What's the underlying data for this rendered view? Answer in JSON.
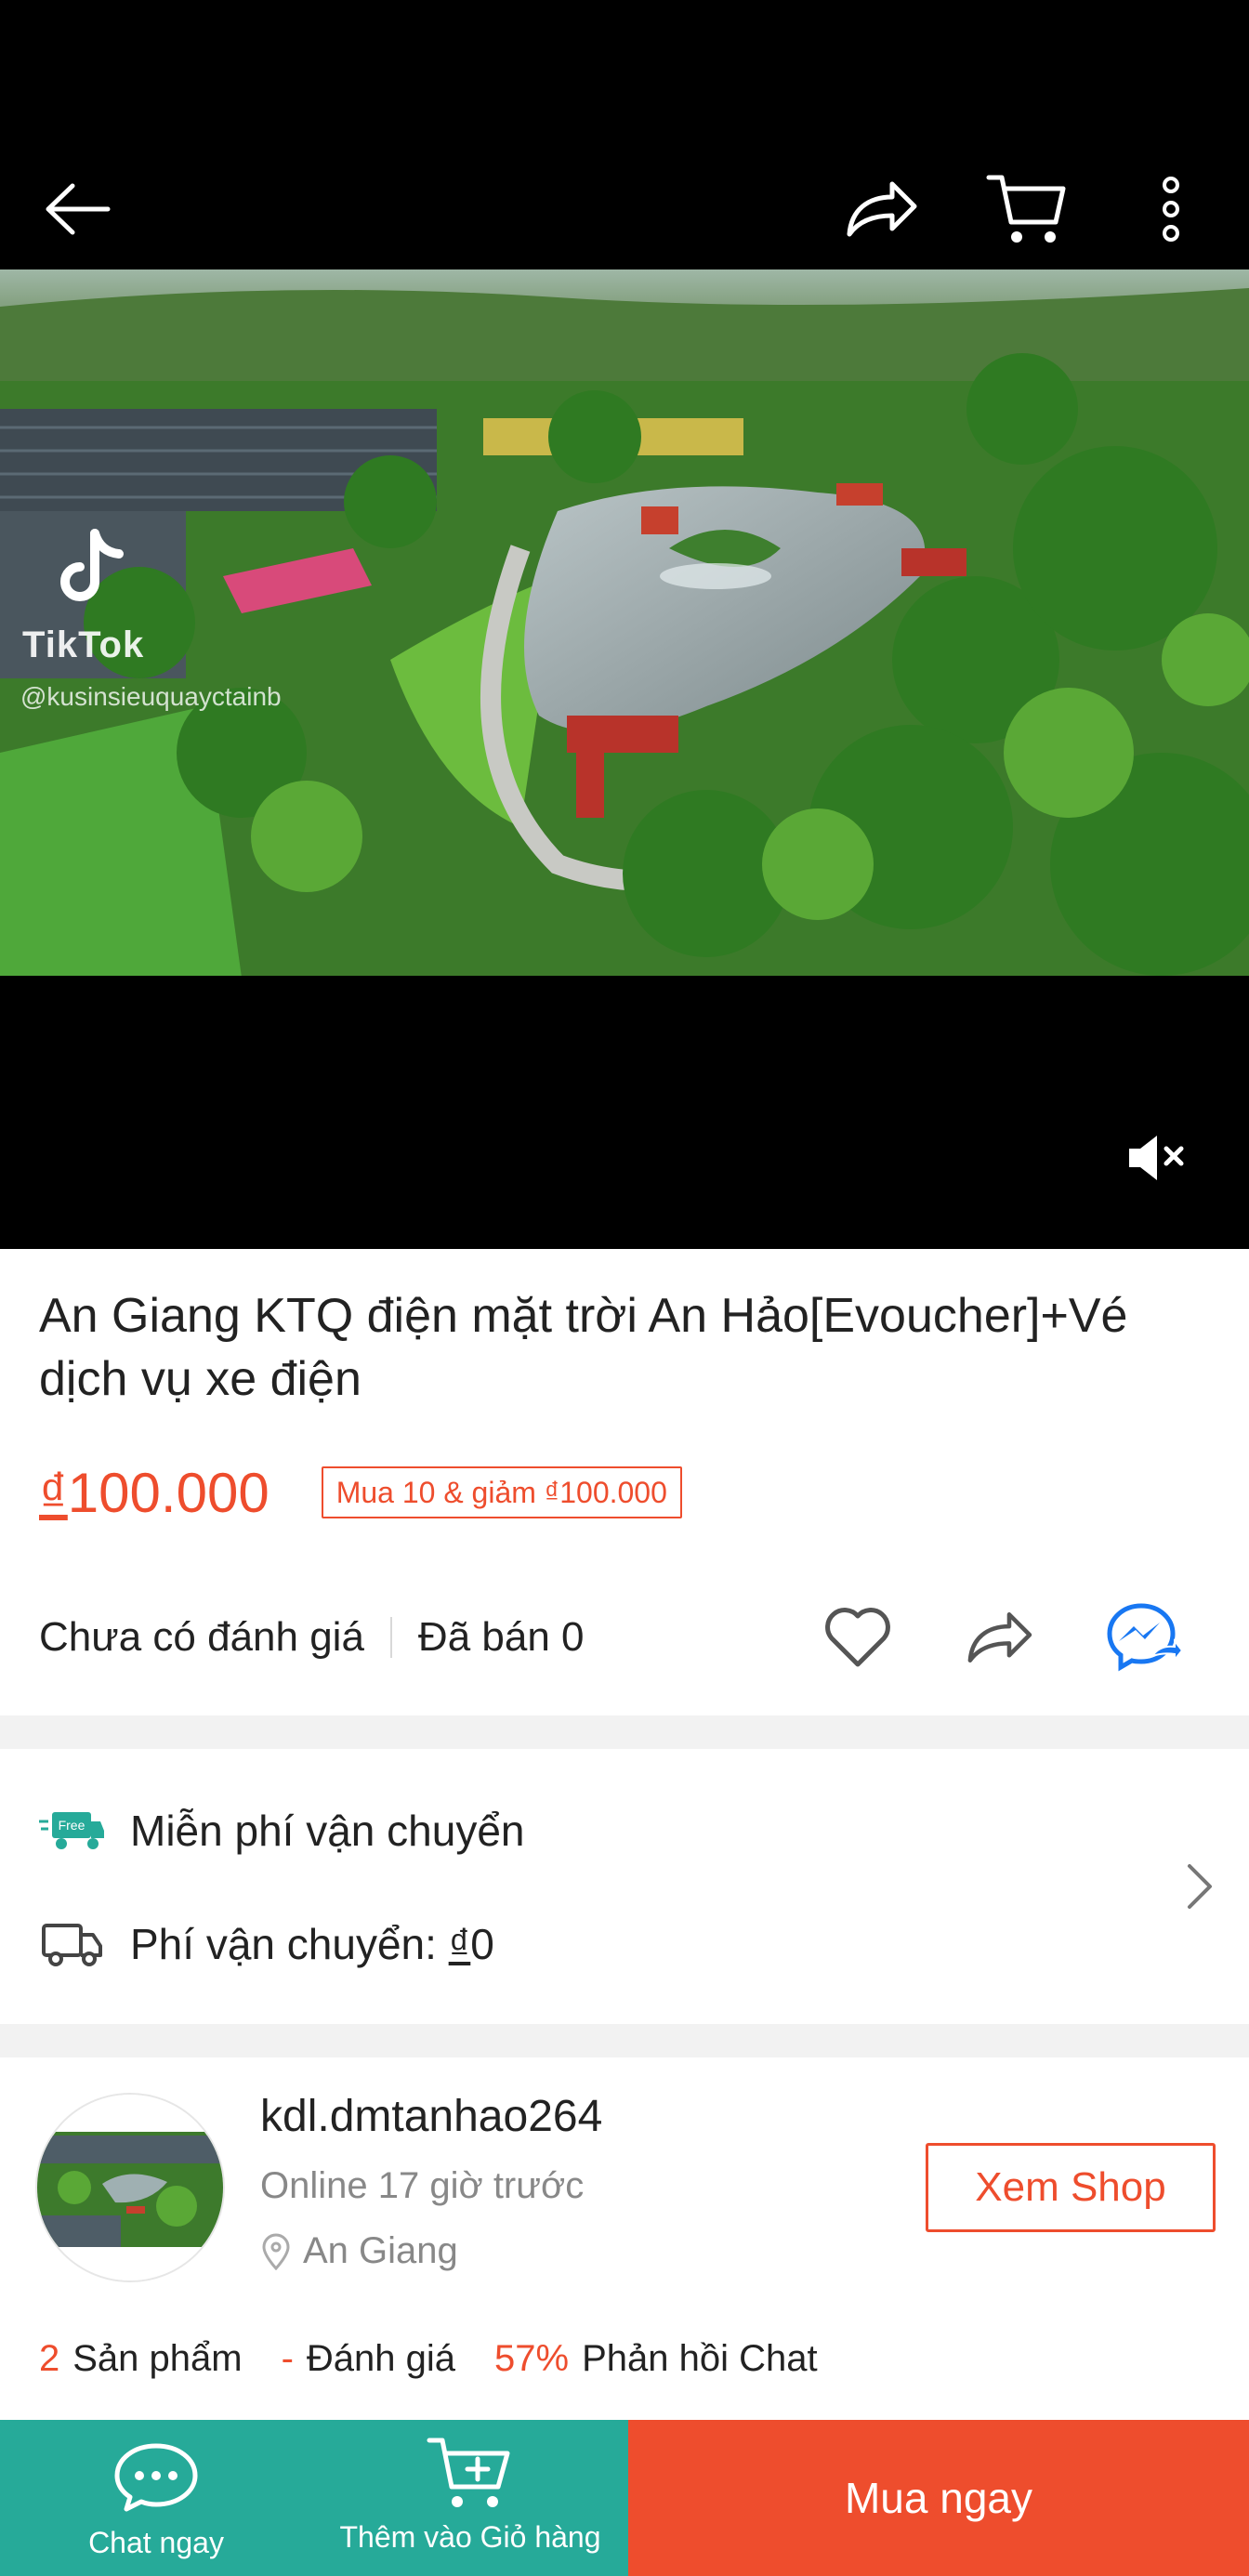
{
  "media": {
    "watermark_brand": "TikTok",
    "watermark_handle": "@kusinsieuquayctainb"
  },
  "product": {
    "title": "An Giang KTQ điện mặt trời An Hảo[Evoucher]+Vé dịch vụ xe điện",
    "price_currency": "₫",
    "price_value": "100.000",
    "promo_badge": "Mua 10 & giảm ₫100.000",
    "rating_text": "Chưa có đánh giá",
    "sold_text": "Đã bán 0"
  },
  "shipping": {
    "free_label": "Miễn phí vận chuyển",
    "fee_label": "Phí vận chuyển: ",
    "fee_currency": "₫",
    "fee_value": "0",
    "free_badge": "Free"
  },
  "shop": {
    "name": "kdl.dmtanhao264",
    "online": "Online 17 giờ trước",
    "location": "An Giang",
    "view_button": "Xem Shop",
    "products_count": "2",
    "products_label": "Sản phẩm",
    "ratings_count": "-",
    "ratings_label": "Đánh giá",
    "chat_response_rate": "57%",
    "chat_response_label": "Phản hồi Chat"
  },
  "bottom_bar": {
    "chat_label": "Chat ngay",
    "add_to_cart_label": "Thêm vào Giỏ hàng",
    "buy_now_label": "Mua ngay"
  },
  "colors": {
    "accent": "#ee4d2d",
    "teal": "#26aa99",
    "messenger_blue": "#1877f2"
  },
  "icons": [
    "back-arrow-icon",
    "share-icon",
    "cart-icon",
    "more-vertical-icon",
    "mute-icon",
    "heart-icon",
    "messenger-icon",
    "free-shipping-truck-icon",
    "truck-icon",
    "chevron-right-icon",
    "location-pin-icon",
    "chat-bubble-icon",
    "add-to-cart-icon",
    "tiktok-logo-icon"
  ]
}
